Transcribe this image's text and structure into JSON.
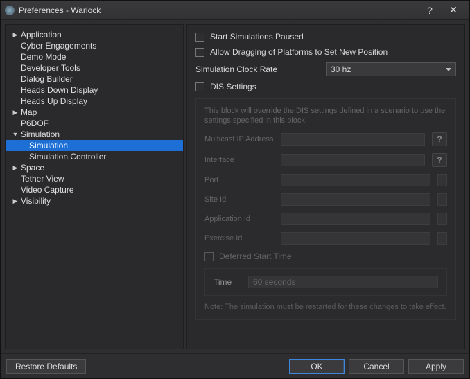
{
  "window": {
    "title": "Preferences - Warlock"
  },
  "sidebar": {
    "items": [
      {
        "label": "Application",
        "expandable": true
      },
      {
        "label": "Cyber Engagements"
      },
      {
        "label": "Demo Mode"
      },
      {
        "label": "Developer Tools"
      },
      {
        "label": "Dialog Builder"
      },
      {
        "label": "Heads Down Display"
      },
      {
        "label": "Heads Up Display"
      },
      {
        "label": "Map",
        "expandable": true
      },
      {
        "label": "P6DOF"
      },
      {
        "label": "Simulation",
        "expandable": true,
        "expanded": true
      },
      {
        "label": "Simulation",
        "child": true,
        "selected": true
      },
      {
        "label": "Simulation Controller",
        "child": true
      },
      {
        "label": "Space",
        "expandable": true
      },
      {
        "label": "Tether View"
      },
      {
        "label": "Video Capture"
      },
      {
        "label": "Visibility",
        "expandable": true
      }
    ]
  },
  "content": {
    "start_paused_label": "Start Simulations Paused",
    "allow_drag_label": "Allow Dragging of Platforms to Set New Position",
    "clock_rate_label": "Simulation Clock Rate",
    "clock_rate_value": "30 hz",
    "dis_settings_label": "DIS Settings",
    "dis_hint": "This block will override the DIS settings defined in a scenario to use the settings specified in this block.",
    "multicast_label": "Multicast IP Address",
    "interface_label": "Interface",
    "port_label": "Port",
    "site_label": "Site Id",
    "app_label": "Application Id",
    "exercise_label": "Exercise Id",
    "deferred_label": "Deferred Start Time",
    "time_label": "Time",
    "time_value": "60 seconds",
    "note": "Note: The simulation must be restarted for these changes to take effect.",
    "help": "?"
  },
  "footer": {
    "restore": "Restore Defaults",
    "ok": "OK",
    "cancel": "Cancel",
    "apply": "Apply"
  }
}
